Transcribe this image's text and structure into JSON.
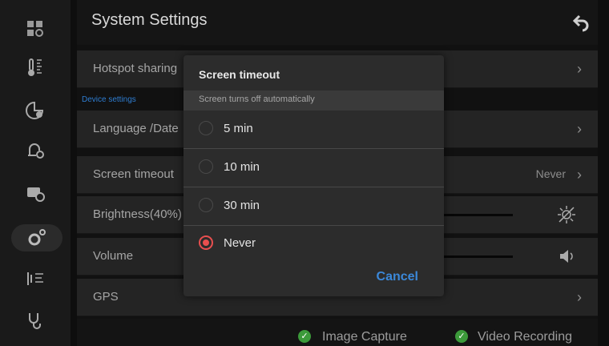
{
  "header": {
    "title": "System Settings"
  },
  "sidebar": {
    "items": [
      {
        "icon": "apps-settings-icon"
      },
      {
        "icon": "temperature-icon"
      },
      {
        "icon": "chart-settings-icon"
      },
      {
        "icon": "alarm-settings-icon"
      },
      {
        "icon": "camera-settings-icon"
      },
      {
        "icon": "system-settings-icon",
        "active": true
      },
      {
        "icon": "signal-icon"
      },
      {
        "icon": "stethoscope-icon"
      }
    ]
  },
  "settings": {
    "section_label": "Device settings",
    "rows": [
      {
        "label": "Hotspot sharing",
        "value": ""
      },
      {
        "label": "Language /Date",
        "value": ""
      },
      {
        "label": "Screen timeout",
        "value": "Never"
      },
      {
        "label": "Brightness(40%)",
        "value": ""
      },
      {
        "label": "Volume",
        "value": ""
      },
      {
        "label": "GPS",
        "value": ""
      }
    ]
  },
  "footer": {
    "image_capture": "Image Capture",
    "video_recording": "Video Recording"
  },
  "dialog": {
    "title": "Screen timeout",
    "subtitle": "Screen turns off automatically",
    "options": [
      {
        "label": "5 min",
        "selected": false
      },
      {
        "label": "10 min",
        "selected": false
      },
      {
        "label": "30 min",
        "selected": false
      },
      {
        "label": "Never",
        "selected": true
      }
    ],
    "cancel_label": "Cancel"
  },
  "colors": {
    "accent_blue": "#3b88d9",
    "radio_selected": "#e94f4f",
    "check_green": "#3c9a3a"
  }
}
